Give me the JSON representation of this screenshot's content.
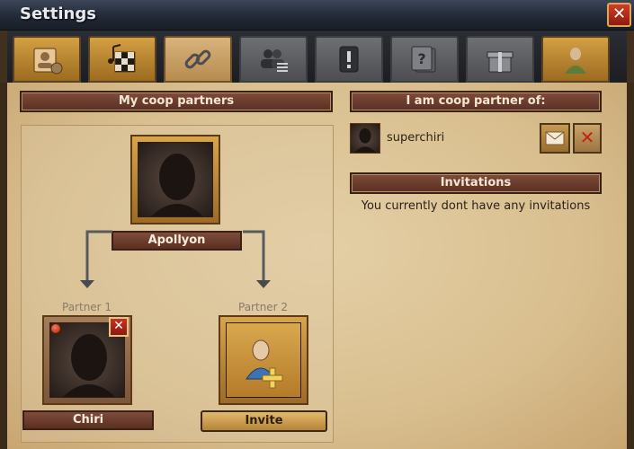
{
  "window": {
    "title": "Settings",
    "close_label": "✕"
  },
  "tabs": [
    {
      "name": "profile"
    },
    {
      "name": "music-games"
    },
    {
      "name": "coop-links",
      "active": true
    },
    {
      "name": "friends"
    },
    {
      "name": "notifications"
    },
    {
      "name": "help"
    },
    {
      "name": "gifts"
    },
    {
      "name": "avatar"
    }
  ],
  "coop": {
    "my_partners_header": "My coop partners",
    "owner_name": "Apollyon",
    "partner1_label": "Partner 1",
    "partner2_label": "Partner 2",
    "partner1_name": "Chiri",
    "partner1_remove": "✕",
    "invite_label": "Invite"
  },
  "partner_of": {
    "header": "I am coop partner of:",
    "rows": [
      {
        "name": "superchiri",
        "remove": "✕"
      }
    ]
  },
  "invitations": {
    "header": "Invitations",
    "empty_text": "You currently dont have any invitations"
  },
  "colors": {
    "accent": "#7e4c3b",
    "parchment": "#e4cfa6",
    "gold": "#d9a44a"
  }
}
